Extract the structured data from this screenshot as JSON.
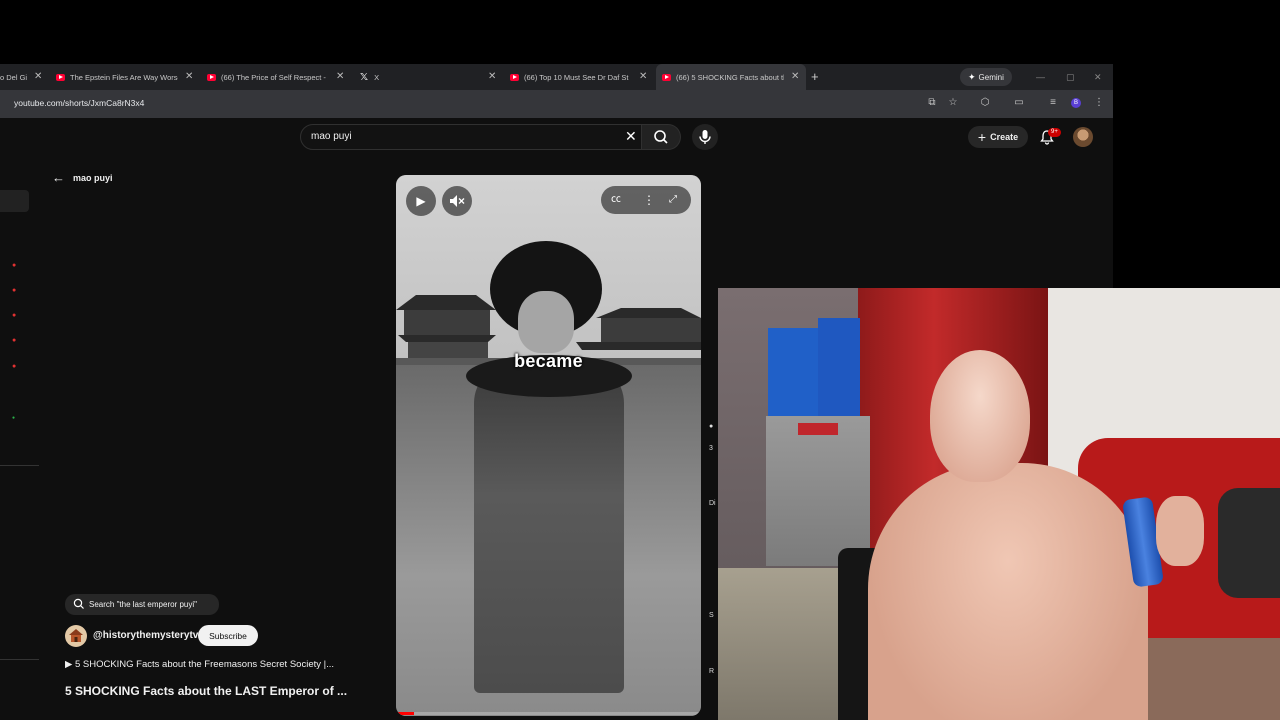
{
  "browser": {
    "tabs": [
      {
        "title": "o Del Gi",
        "icon": "page-icon",
        "active": false
      },
      {
        "title": "The Epstein Files Are Way Worse",
        "icon": "youtube-icon",
        "active": false
      },
      {
        "title": "(66) The Price of Self Respect -",
        "icon": "youtube-icon",
        "active": false
      },
      {
        "title": "X",
        "icon": "x-logo-icon",
        "active": false
      },
      {
        "title": "(66) Top 10 Must See Dr Daf St",
        "icon": "youtube-icon",
        "active": false
      },
      {
        "title": "(66) 5 SHOCKING Facts about th",
        "icon": "youtube-icon",
        "active": true
      }
    ],
    "gemini_label": "Gemini",
    "url": "youtube.com/shorts/JxmCa8rN3x4",
    "profile_initial": "B"
  },
  "youtube": {
    "search_query": "mao puyi",
    "create_label": "Create",
    "notification_badge": "9+",
    "back_label": "mao puyi",
    "video_caption": "became",
    "search_suggestion": "Search \"the last emperor puyi\"",
    "channel_handle": "@historythemysterytv",
    "subscribe_label": "Subscribe",
    "playlist_label": "▶ 5 SHOCKING Facts about the Freemasons Secret Society |...",
    "video_title": "5 SHOCKING Facts about the LAST Emperor of ...",
    "right_column_partial": [
      "3",
      "Di",
      "S",
      "R"
    ]
  },
  "colors": {
    "youtube_red": "#ff0033",
    "page_bg": "#0f0f0f",
    "chrome_bg": "#202124"
  }
}
